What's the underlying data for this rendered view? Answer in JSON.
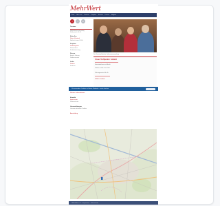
{
  "site": {
    "logo": "MehrWert",
    "nav": [
      "Start",
      "Über uns",
      "Termine",
      "Projekte",
      "Kontakt",
      "Presse",
      "Mitglied"
    ]
  },
  "sidebar": {
    "social": [
      "f",
      "t",
      "in"
    ],
    "blocks": [
      {
        "head": "Termine",
        "lines": [
          "Mitgliederversammlung",
          "Stammtisch 14.05."
        ]
      },
      {
        "head": "Aktuelles",
        "red": "Neuer Vorstand",
        "lines": [
          "Nachricht vom 02.04."
        ]
      },
      {
        "head": "Projekte",
        "red": "Stadtteilgarten",
        "lines": [
          "Sommerfest",
          "Kinderbetreuung"
        ]
      },
      {
        "head": "Presse",
        "lines": [
          "Bericht Zeitung",
          "Radiointerview"
        ]
      },
      {
        "head": "Links",
        "red": "Partner",
        "lines": [
          "Förderer"
        ]
      }
    ]
  },
  "photo": {
    "caption": "Der Vorstand bei der Jahresversammlung"
  },
  "panel": {
    "title": "Unser Treffpunkt / Anfahrt",
    "lines": [
      "Gemeindehaus am Markt",
      "Telefon: 0123 / 45 67 89",
      "Öffnungszeiten Mo–Fr",
      "E-Mail schreiben"
    ]
  },
  "bluebar": {
    "text": "Wir verwenden Cookies auf dieser Webseite – mehr erfahren",
    "button": "OK"
  },
  "under": {
    "red1": "Weitere Informationen",
    "dark1": "Kontakt",
    "red2": "Impressum",
    "grey1": "Datenschutz",
    "dark2": "Veranstaltungen",
    "grey2": "Unsere nächsten Treffen",
    "red3": "Anmeldung"
  },
  "footer": {
    "text": "© MehrWert e.V. – Impressum – Datenschutz"
  }
}
